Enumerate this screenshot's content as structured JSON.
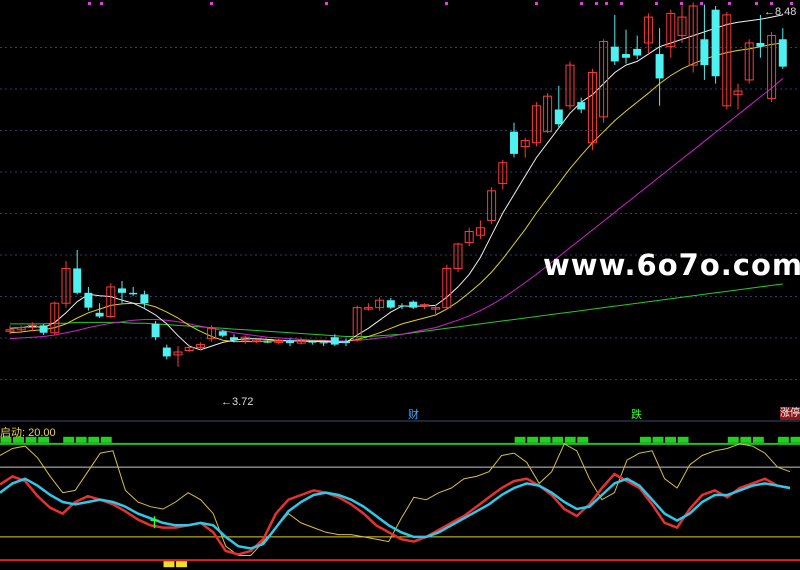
{
  "chart_data": {
    "type": "candlestick",
    "title": "",
    "price_panel": {
      "ylim": [
        3.0,
        8.6
      ],
      "high_label": "8.48",
      "low_label": "3.72",
      "candles": [
        [
          4.2,
          4.28,
          4.16,
          4.22
        ],
        [
          4.22,
          4.28,
          4.18,
          4.25
        ],
        [
          4.25,
          4.32,
          4.2,
          4.28
        ],
        [
          4.28,
          4.3,
          4.15,
          4.18
        ],
        [
          4.18,
          4.6,
          4.15,
          4.58
        ],
        [
          4.58,
          5.15,
          4.52,
          5.05
        ],
        [
          5.05,
          5.3,
          4.7,
          4.72
        ],
        [
          4.72,
          4.8,
          4.48,
          4.52
        ],
        [
          4.45,
          4.58,
          4.38,
          4.4
        ],
        [
          4.4,
          4.85,
          4.38,
          4.8
        ],
        [
          4.78,
          4.88,
          4.58,
          4.72
        ],
        [
          4.72,
          4.8,
          4.68,
          4.7
        ],
        [
          4.7,
          4.75,
          4.52,
          4.58
        ],
        [
          4.3,
          4.34,
          4.08,
          4.12
        ],
        [
          3.98,
          4.02,
          3.82,
          3.86
        ],
        [
          3.88,
          4.0,
          3.72,
          3.92
        ],
        [
          3.94,
          4.02,
          3.92,
          3.98
        ],
        [
          3.98,
          4.05,
          3.94,
          4.02
        ],
        [
          4.1,
          4.28,
          4.06,
          4.24
        ],
        [
          4.2,
          4.22,
          4.12,
          4.14
        ],
        [
          4.12,
          4.16,
          4.05,
          4.08
        ],
        [
          4.08,
          4.14,
          4.03,
          4.12
        ],
        [
          4.06,
          4.1,
          4.04,
          4.08
        ],
        [
          4.06,
          4.08,
          4.04,
          4.05
        ],
        [
          4.05,
          4.1,
          4.02,
          4.08
        ],
        [
          4.08,
          4.1,
          4.0,
          4.04
        ],
        [
          4.04,
          4.1,
          4.02,
          4.08
        ],
        [
          4.06,
          4.08,
          4.02,
          4.05
        ],
        [
          4.05,
          4.08,
          4.0,
          4.04
        ],
        [
          4.12,
          4.16,
          4.0,
          4.02
        ],
        [
          4.06,
          4.1,
          4.0,
          4.04
        ],
        [
          4.08,
          4.55,
          4.06,
          4.52
        ],
        [
          4.5,
          4.58,
          4.48,
          4.52
        ],
        [
          4.52,
          4.66,
          4.48,
          4.62
        ],
        [
          4.62,
          4.65,
          4.5,
          4.52
        ],
        [
          4.55,
          4.58,
          4.5,
          4.54
        ],
        [
          4.6,
          4.62,
          4.5,
          4.52
        ],
        [
          4.55,
          4.58,
          4.5,
          4.56
        ],
        [
          4.5,
          4.56,
          4.42,
          4.52
        ],
        [
          4.52,
          5.1,
          4.5,
          5.05
        ],
        [
          5.05,
          5.4,
          5.0,
          5.38
        ],
        [
          5.4,
          5.6,
          5.35,
          5.55
        ],
        [
          5.5,
          5.7,
          5.45,
          5.6
        ],
        [
          5.7,
          6.15,
          5.65,
          6.1
        ],
        [
          6.2,
          6.52,
          6.12,
          6.48
        ],
        [
          6.9,
          7.02,
          6.55,
          6.6
        ],
        [
          6.7,
          6.82,
          6.55,
          6.78
        ],
        [
          6.75,
          7.3,
          6.7,
          7.25
        ],
        [
          6.9,
          7.42,
          6.88,
          7.38
        ],
        [
          7.2,
          7.52,
          6.95,
          7.0
        ],
        [
          7.25,
          7.85,
          7.2,
          7.8
        ],
        [
          7.3,
          7.36,
          7.15,
          7.2
        ],
        [
          6.75,
          7.75,
          6.65,
          7.7
        ],
        [
          7.1,
          8.15,
          7.02,
          8.12
        ],
        [
          8.05,
          8.48,
          7.8,
          7.85
        ],
        [
          7.95,
          8.28,
          7.82,
          7.9
        ],
        [
          8.02,
          8.2,
          7.88,
          7.93
        ],
        [
          8.1,
          8.5,
          7.95,
          8.45
        ],
        [
          7.95,
          8.3,
          7.25,
          7.62
        ],
        [
          8.05,
          8.55,
          7.9,
          8.5
        ],
        [
          8.2,
          8.6,
          8.1,
          8.45
        ],
        [
          7.8,
          8.65,
          7.7,
          8.6
        ],
        [
          8.15,
          8.62,
          7.6,
          7.8
        ],
        [
          8.55,
          8.6,
          7.55,
          7.65
        ],
        [
          7.25,
          8.52,
          7.2,
          8.48
        ],
        [
          7.4,
          7.55,
          7.2,
          7.45
        ],
        [
          7.6,
          8.15,
          7.55,
          8.1
        ],
        [
          8.1,
          8.48,
          7.9,
          8.05
        ],
        [
          7.35,
          8.25,
          7.3,
          8.2
        ],
        [
          8.15,
          8.3,
          7.75,
          7.78
        ]
      ],
      "ma5": [
        4.24,
        4.25,
        4.27,
        4.25,
        4.32,
        4.45,
        4.6,
        4.7,
        4.68,
        4.67,
        4.62,
        4.58,
        4.51,
        4.42,
        4.3,
        4.14,
        4.0,
        3.95,
        4.0,
        4.05,
        4.08,
        4.1,
        4.1,
        4.09,
        4.08,
        4.07,
        4.07,
        4.06,
        4.06,
        4.05,
        4.05,
        4.15,
        4.24,
        4.35,
        4.46,
        4.54,
        4.54,
        4.54,
        4.55,
        4.66,
        4.8,
        4.97,
        5.2,
        5.5,
        5.8,
        6.05,
        6.3,
        6.55,
        6.75,
        6.95,
        7.15,
        7.3,
        7.4,
        7.55,
        7.7,
        7.8,
        7.85,
        7.95,
        8.05,
        8.1,
        8.15,
        8.2,
        8.25,
        8.3,
        8.35,
        8.38,
        8.4,
        8.42,
        8.45,
        8.48
      ],
      "ma10": [
        4.18,
        4.19,
        4.21,
        4.22,
        4.25,
        4.3,
        4.38,
        4.45,
        4.5,
        4.55,
        4.57,
        4.58,
        4.57,
        4.53,
        4.46,
        4.38,
        4.28,
        4.2,
        4.13,
        4.08,
        4.06,
        4.06,
        4.06,
        4.07,
        4.07,
        4.07,
        4.07,
        4.07,
        4.07,
        4.06,
        4.06,
        4.09,
        4.13,
        4.18,
        4.24,
        4.3,
        4.34,
        4.38,
        4.42,
        4.5,
        4.6,
        4.72,
        4.85,
        5.0,
        5.18,
        5.38,
        5.58,
        5.8,
        6.0,
        6.2,
        6.4,
        6.58,
        6.75,
        6.9,
        7.05,
        7.18,
        7.3,
        7.42,
        7.55,
        7.66,
        7.75,
        7.82,
        7.88,
        7.93,
        7.97,
        8.0,
        8.02,
        8.05,
        8.08,
        8.1
      ],
      "ma20": [
        4.1,
        4.11,
        4.12,
        4.13,
        4.15,
        4.18,
        4.21,
        4.25,
        4.28,
        4.31,
        4.33,
        4.35,
        4.36,
        4.36,
        4.35,
        4.33,
        4.3,
        4.27,
        4.24,
        4.21,
        4.18,
        4.16,
        4.14,
        4.12,
        4.11,
        4.1,
        4.09,
        4.08,
        4.08,
        4.07,
        4.07,
        4.08,
        4.09,
        4.11,
        4.13,
        4.16,
        4.19,
        4.22,
        4.25,
        4.3,
        4.35,
        4.41,
        4.48,
        4.56,
        4.65,
        4.75,
        4.86,
        4.97,
        5.09,
        5.21,
        5.33,
        5.45,
        5.57,
        5.69,
        5.81,
        5.93,
        6.05,
        6.17,
        6.29,
        6.41,
        6.53,
        6.65,
        6.77,
        6.89,
        7.01,
        7.13,
        7.25,
        7.37,
        7.49,
        7.62
      ],
      "ma60": [
        4.3,
        4.3,
        4.3,
        4.3,
        4.31,
        4.31,
        4.32,
        4.32,
        4.32,
        4.32,
        4.32,
        4.31,
        4.31,
        4.3,
        4.29,
        4.28,
        4.27,
        4.26,
        4.25,
        4.24,
        4.23,
        4.22,
        4.21,
        4.2,
        4.19,
        4.18,
        4.17,
        4.16,
        4.15,
        4.14,
        4.13,
        4.13,
        4.13,
        4.14,
        4.15,
        4.16,
        4.18,
        4.2,
        4.22,
        4.24,
        4.26,
        4.28,
        4.3,
        4.32,
        4.34,
        4.36,
        4.38,
        4.4,
        4.42,
        4.44,
        4.46,
        4.48,
        4.5,
        4.52,
        4.54,
        4.56,
        4.58,
        4.6,
        4.62,
        4.64,
        4.66,
        4.68,
        4.7,
        4.72,
        4.74,
        4.76,
        4.78,
        4.8,
        4.82,
        4.84
      ]
    },
    "markers": {
      "cai": "财",
      "die": "跌",
      "zhangting": "涨停"
    },
    "indicator_panel": {
      "title": "启动: 20.00",
      "ylim": [
        -5,
        105
      ],
      "levels": [
        100,
        80,
        20
      ],
      "red": [
        65,
        72,
        68,
        55,
        45,
        40,
        50,
        55,
        52,
        48,
        42,
        35,
        30,
        28,
        28,
        30,
        32,
        24,
        8,
        5,
        8,
        18,
        40,
        52,
        56,
        60,
        58,
        54,
        48,
        40,
        30,
        24,
        18,
        16,
        20,
        26,
        32,
        38,
        46,
        54,
        62,
        68,
        70,
        64,
        56,
        44,
        38,
        48,
        62,
        74,
        68,
        62,
        48,
        32,
        28,
        44,
        56,
        60,
        54,
        62,
        66,
        70,
        64,
        62
      ],
      "cyan": [
        58,
        66,
        70,
        64,
        56,
        50,
        48,
        50,
        52,
        50,
        46,
        40,
        36,
        32,
        30,
        30,
        32,
        30,
        20,
        12,
        10,
        14,
        28,
        42,
        50,
        56,
        58,
        56,
        52,
        46,
        38,
        30,
        24,
        20,
        20,
        24,
        30,
        36,
        42,
        48,
        56,
        62,
        66,
        64,
        58,
        50,
        44,
        46,
        56,
        66,
        70,
        64,
        52,
        40,
        34,
        40,
        50,
        56,
        56,
        60,
        64,
        66,
        64,
        62
      ],
      "yellow": [
        90,
        96,
        98,
        88,
        72,
        58,
        60,
        76,
        92,
        94,
        60,
        50,
        46,
        44,
        50,
        58,
        52,
        40,
        12,
        4,
        4,
        16,
        28,
        40,
        32,
        28,
        24,
        22,
        22,
        20,
        18,
        16,
        36,
        54,
        52,
        58,
        62,
        70,
        72,
        76,
        90,
        92,
        84,
        66,
        76,
        100,
        94,
        70,
        52,
        58,
        86,
        92,
        94,
        70,
        62,
        82,
        90,
        94,
        96,
        100,
        98,
        92,
        80,
        76
      ],
      "top_green_blocks": [
        0,
        1,
        2,
        3,
        5,
        6,
        7,
        8,
        41,
        42,
        43,
        44,
        45,
        46,
        51,
        52,
        53,
        54,
        58,
        59,
        60,
        62,
        63,
        64,
        65,
        66
      ],
      "bottom_yellow_blocks": [
        13,
        14
      ],
      "signal_index": 12
    }
  }
}
